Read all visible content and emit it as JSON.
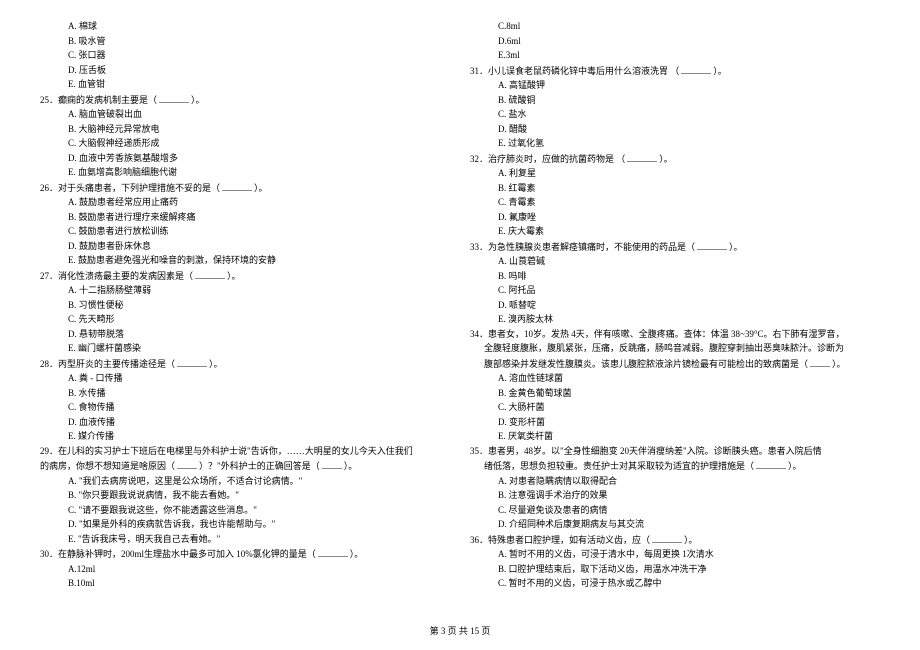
{
  "left": {
    "q24opts": [
      {
        "l": "A",
        "t": "棉球"
      },
      {
        "l": "B",
        "t": "吸水管"
      },
      {
        "l": "C",
        "t": "张口器"
      },
      {
        "l": "D",
        "t": "压舌板"
      },
      {
        "l": "E",
        "t": "血管钳"
      }
    ],
    "q25": {
      "num": "25．",
      "text": "癫痫的发病机制主要是（",
      "tail": "）。"
    },
    "q25opts": [
      {
        "l": "A",
        "t": "脑血管破裂出血"
      },
      {
        "l": "B",
        "t": "大脑神经元异常放电"
      },
      {
        "l": "C",
        "t": "大脑假神经递质形成"
      },
      {
        "l": "D",
        "t": "血液中芳香族氨基酸增多"
      },
      {
        "l": "E",
        "t": "血氨增高影响脑细胞代谢"
      }
    ],
    "q26": {
      "num": "26．",
      "text": "对于头痛患者，下列护理措施不妥的是（",
      "tail": "）。"
    },
    "q26opts": [
      {
        "l": "A",
        "t": "鼓励患者经常应用止痛药"
      },
      {
        "l": "B",
        "t": "鼓励患者进行理疗来缓解疼痛"
      },
      {
        "l": "C",
        "t": "鼓励患者进行放松训练"
      },
      {
        "l": "D",
        "t": "鼓励患者卧床休息"
      },
      {
        "l": "E",
        "t": "鼓励患者避免强光和噪音的刺激，保持环境的安静"
      }
    ],
    "q27": {
      "num": "27．",
      "text": "消化性溃疡最主要的发病因素是（",
      "tail": "）。"
    },
    "q27opts": [
      {
        "l": "A",
        "t": "十二指肠肠壁薄弱"
      },
      {
        "l": "B",
        "t": "习惯性便秘"
      },
      {
        "l": "C",
        "t": "先天畸形"
      },
      {
        "l": "D",
        "t": "悬韧带脱落"
      },
      {
        "l": "E",
        "t": "幽门螺杆菌感染"
      }
    ],
    "q28": {
      "num": "28．",
      "text": "丙型肝炎的主要传播途径是（",
      "tail": "）。"
    },
    "q28opts": [
      {
        "l": "A",
        "t": "粪 - 口传播"
      },
      {
        "l": "B",
        "t": "水传播"
      },
      {
        "l": "C",
        "t": "食物传播"
      },
      {
        "l": "D",
        "t": "血液传播"
      },
      {
        "l": "E",
        "t": "媒介传播"
      }
    ],
    "q29": {
      "num": "29．",
      "text": "在儿科的实习护士下班后在电梯里与外科护士说\"告诉你，……大明星的女儿今天入住我们"
    },
    "q29line2": "的病房，你想不想知道是啥原因（",
    "q29tail": "）？\"外科护士的正确回答是（",
    "q29tail2": "）。",
    "q29opts": [
      {
        "l": "A",
        "t": "\"我们去病房说吧，这里是公众场所，不适合讨论病情。\""
      },
      {
        "l": "B",
        "t": "\"你只要跟我说说病情，我不能去看她。\""
      },
      {
        "l": "C",
        "t": "\"请不要跟我说这些，你不能透露这些消息。\""
      },
      {
        "l": "D",
        "t": "\"如果是外科的疾病就告诉我，我也许能帮助与。\""
      },
      {
        "l": "E",
        "t": "\"告诉我床号，明天我自己去看她。\""
      }
    ],
    "q30": {
      "num": "30．",
      "text": "在静脉补钾时，200ml生理盐水中最多可加入   10%氯化钾的量是（",
      "tail": "）。"
    },
    "q30opts": [
      {
        "l": "A",
        "t": "12ml"
      },
      {
        "l": "B",
        "t": "10ml"
      }
    ]
  },
  "right": {
    "q30opts": [
      {
        "l": "C",
        "t": "8ml"
      },
      {
        "l": "D",
        "t": "6ml"
      },
      {
        "l": "E",
        "t": "3ml"
      }
    ],
    "q31": {
      "num": "31．",
      "text": "小儿误食老鼠药磷化锌中毒后用什么溶液洗胃    （",
      "tail": "）。"
    },
    "q31opts": [
      {
        "l": "A",
        "t": "高锰酸钾"
      },
      {
        "l": "B",
        "t": "硫酸铜"
      },
      {
        "l": "C",
        "t": "盐水"
      },
      {
        "l": "D",
        "t": "醋酸"
      },
      {
        "l": "E",
        "t": "过氧化氢"
      }
    ],
    "q32": {
      "num": "32．",
      "text": "治疗肺炎时，应做的抗菌药物是   （",
      "tail": "）。"
    },
    "q32opts": [
      {
        "l": "A",
        "t": "利复星"
      },
      {
        "l": "B",
        "t": "红霉素"
      },
      {
        "l": "C",
        "t": "青霉素"
      },
      {
        "l": "D",
        "t": "氟康唑"
      },
      {
        "l": "E",
        "t": "庆大霉素"
      }
    ],
    "q33": {
      "num": "33．",
      "text": "为急性胰腺炎患者解痉镇痛时，不能使用的药品是（",
      "tail": "）。"
    },
    "q33opts": [
      {
        "l": "A",
        "t": "山莨菪碱"
      },
      {
        "l": "B",
        "t": "吗啡"
      },
      {
        "l": "C",
        "t": "阿托品"
      },
      {
        "l": "D",
        "t": "哌替啶"
      },
      {
        "l": "E",
        "t": "溴丙胺太林"
      }
    ],
    "q34": {
      "num": "34．",
      "text": "患者女，10岁。发热 4天，伴有咳嗽、全腹疼痛。查体：体温   38~39°C。右下肺有湿罗音，"
    },
    "q34line2": "全腹轻度腹胀，腹肌紧张，压痛，反跳痛，肠鸣音减弱。腹腔穿刺抽出恶臭味脓汁。诊断为",
    "q34line3": "腹部感染并发继发性腹膜炎。该患儿腹腔脓液涂片镜检最有可能检出的致病菌是（",
    "q34tail": "）。",
    "q34opts": [
      {
        "l": "A",
        "t": "溶血性链球菌"
      },
      {
        "l": "B",
        "t": "金黄色葡萄球菌"
      },
      {
        "l": "C",
        "t": "大肠杆菌"
      },
      {
        "l": "D",
        "t": "变形杆菌"
      },
      {
        "l": "E",
        "t": "厌氧类杆菌"
      }
    ],
    "q35": {
      "num": "35．",
      "text": "患者男，48岁。以\"全身性细胞变   20天伴消瘦纳差\"入院。诊断胰头癌。患者入院后情"
    },
    "q35line2": "绪低落，思想负担较重。责任护士对其采取较为适宜的护理措施是（",
    "q35tail": "）。",
    "q35opts": [
      {
        "l": "A",
        "t": "对患者隐瞒病情以取得配合"
      },
      {
        "l": "B",
        "t": "注意强调手术治疗的效果"
      },
      {
        "l": "C",
        "t": "尽量避免谈及患者的病情"
      },
      {
        "l": "D",
        "t": "介绍同种术后康复期病友与其交流"
      }
    ],
    "q36": {
      "num": "36．",
      "text": "特殊患者口腔护理，如有活动义齿，应（",
      "tail": "）。"
    },
    "q36opts": [
      {
        "l": "A",
        "t": "暂时不用的义齿，可浸于清水中，每周更换     1次清水"
      },
      {
        "l": "B",
        "t": "口腔护理结束后，取下活动义齿，用温水冲洗干净"
      },
      {
        "l": "C",
        "t": "暂时不用的义齿，可浸于热水或乙醇中"
      }
    ]
  },
  "footer": {
    "pre": "第 ",
    "page": "3",
    "mid": " 页 共 ",
    "total": "15",
    "suf": " 页"
  }
}
